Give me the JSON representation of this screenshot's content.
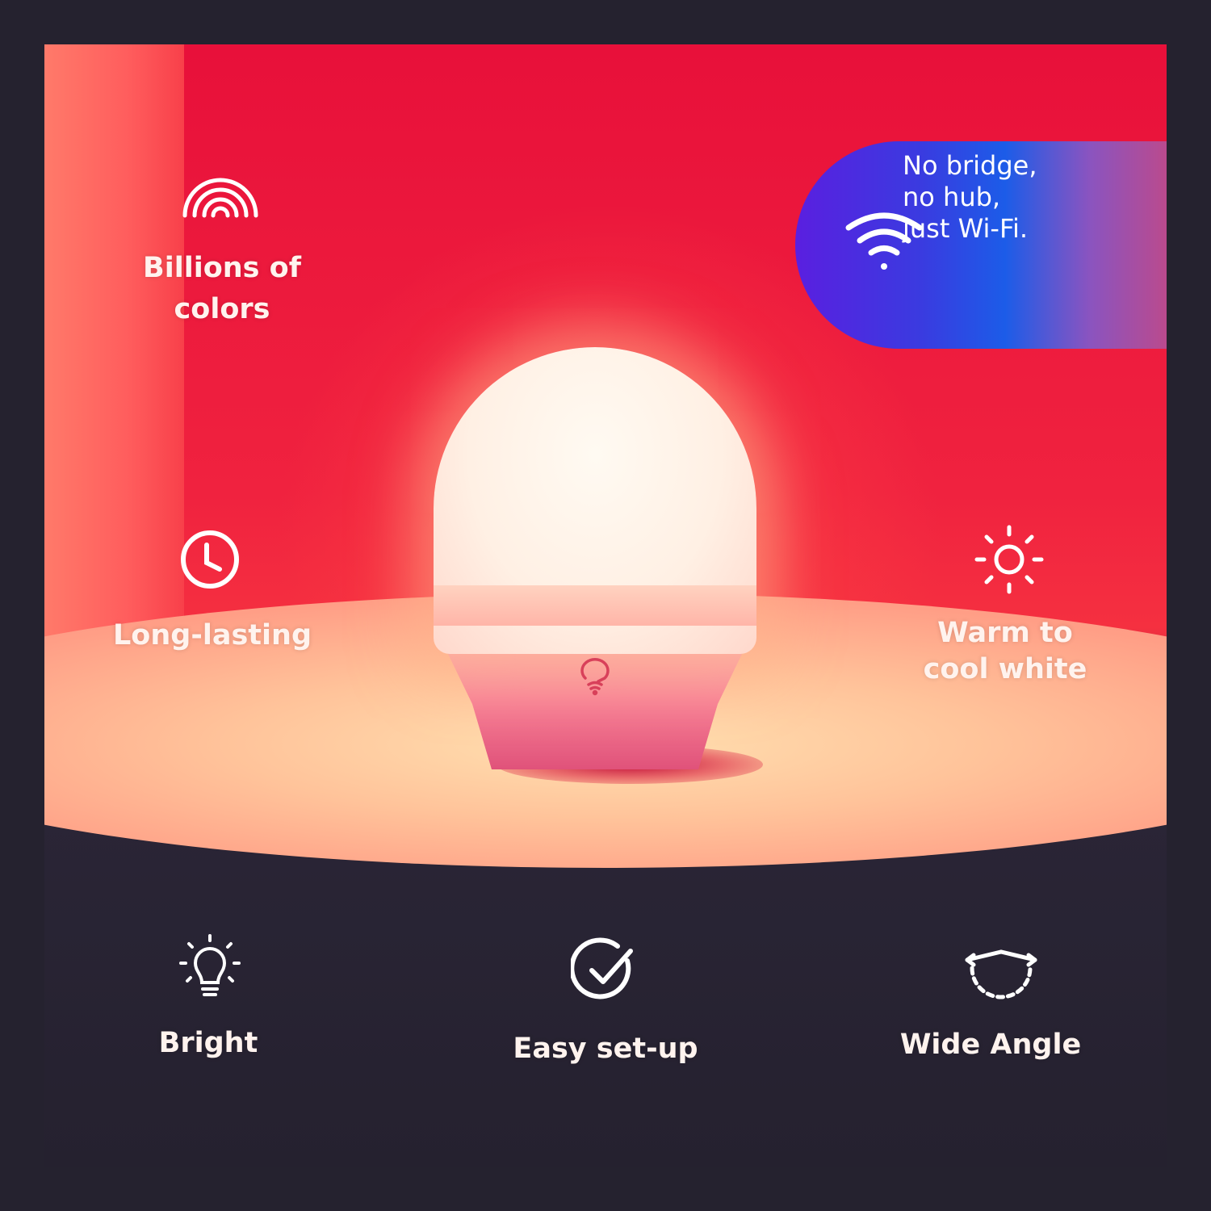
{
  "features": [
    {
      "label_lines": [
        "Billions of",
        "colors"
      ],
      "icon": "rainbow-icon"
    },
    {
      "label_lines": [
        "Long-lasting"
      ],
      "icon": "clock-icon"
    },
    {
      "label_lines": [
        "Warm to",
        "cool white"
      ],
      "icon": "sun-icon"
    },
    {
      "label_lines": [
        "Bright"
      ],
      "icon": "lightbulb-icon"
    },
    {
      "label_lines": [
        "Easy set-up"
      ],
      "icon": "check-circle-icon"
    },
    {
      "label_lines": [
        "Wide Angle"
      ],
      "icon": "wide-angle-icon"
    }
  ],
  "badge": {
    "lines": [
      "No bridge,",
      "no hub,",
      "just Wi-Fi."
    ],
    "icon": "wifi-icon",
    "gradient": [
      "#5a1fe0",
      "#1c5ce8",
      "#d8446e"
    ]
  },
  "colors": {
    "frame": "#25222f",
    "wall": "#e8103a",
    "text": "#fff3ee"
  }
}
